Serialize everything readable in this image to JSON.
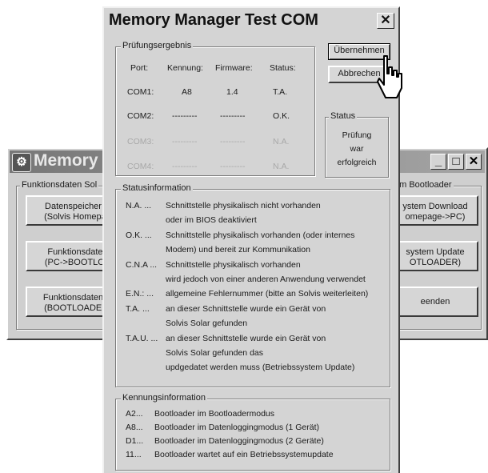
{
  "background_window": {
    "title": "Memory M",
    "app_icon": "gear-icon",
    "group_left_label": "Funktionsdaten Sol",
    "group_right_label": "em Bootloader",
    "btn1": [
      "Datenspeicher D",
      "(Solvis Homepag"
    ],
    "btn2": [
      "Funktionsdaten",
      "(PC->BOOTLOA"
    ],
    "btn3": [
      "Funktionsdaten D",
      "(BOOTLOADER-"
    ],
    "btn4": [
      "ystem Download",
      "omepage->PC)"
    ],
    "btn5": [
      "system Update",
      "OTLOADER)"
    ],
    "btn6": "eenden"
  },
  "dialog": {
    "title": "Memory Manager Test COM",
    "close_label": "✕",
    "ok_label": "Übernehmen",
    "cancel_label": "Abbrechen",
    "pruef": {
      "label": "Prüfungsergebnis",
      "headers": [
        "Port:",
        "Kennung:",
        "Firmware:",
        "Status:"
      ],
      "rows": [
        {
          "port": "COM1:",
          "kennung": "A8",
          "firmware": "1.4",
          "status": "T.A."
        },
        {
          "port": "COM2:",
          "kennung": "---------",
          "firmware": "---------",
          "status": "O.K."
        },
        {
          "port": "COM3:",
          "kennung": "---------",
          "firmware": "---------",
          "status": "N.A."
        },
        {
          "port": "COM4:",
          "kennung": "---------",
          "firmware": "---------",
          "status": "N.A."
        }
      ]
    },
    "status": {
      "label": "Status",
      "lines": [
        "Prüfung",
        "war",
        "erfolgreich"
      ]
    },
    "statusinfo": {
      "label": "Statusinformation",
      "lines": [
        {
          "code": "N.A. ...",
          "text": "Schnittstelle physikalisch nicht vorhanden"
        },
        {
          "code": "",
          "text": "oder im BIOS deaktiviert"
        },
        {
          "code": "O.K. ...",
          "text": "Schnittstelle physikalisch vorhanden (oder internes"
        },
        {
          "code": "",
          "text": "Modem) und bereit zur Kommunikation"
        },
        {
          "code": "C.N.A ...",
          "text": "Schnittstelle physikalisch vorhanden"
        },
        {
          "code": "",
          "text": "wird jedoch von einer anderen Anwendung verwendet"
        },
        {
          "code": "E.N.: ...",
          "text": "allgemeine Fehlernummer (bitte an Solvis weiterleiten)"
        },
        {
          "code": "T.A. ...",
          "text": "an dieser Schnittstelle wurde ein Gerät von"
        },
        {
          "code": "",
          "text": "Solvis Solar gefunden"
        },
        {
          "code": "T.A.U. ...",
          "text": "an dieser Schnittstelle wurde ein Gerät von"
        },
        {
          "code": "",
          "text": "Solvis Solar gefunden das"
        },
        {
          "code": "",
          "text": "updgedatet werden muss (Betriebssystem Update)"
        }
      ]
    },
    "kennung": {
      "label": "Kennungsinformation",
      "lines": [
        {
          "code": "A2...",
          "text": "Bootloader im Bootloadermodus"
        },
        {
          "code": "A8...",
          "text": "Bootloader im Datenloggingmodus (1 Gerät)"
        },
        {
          "code": "D1...",
          "text": "Bootloader im Datenloggingmodus (2 Geräte)"
        },
        {
          "code": "11...",
          "text": "Bootloader wartet auf ein Betriebssystemupdate"
        }
      ]
    }
  }
}
